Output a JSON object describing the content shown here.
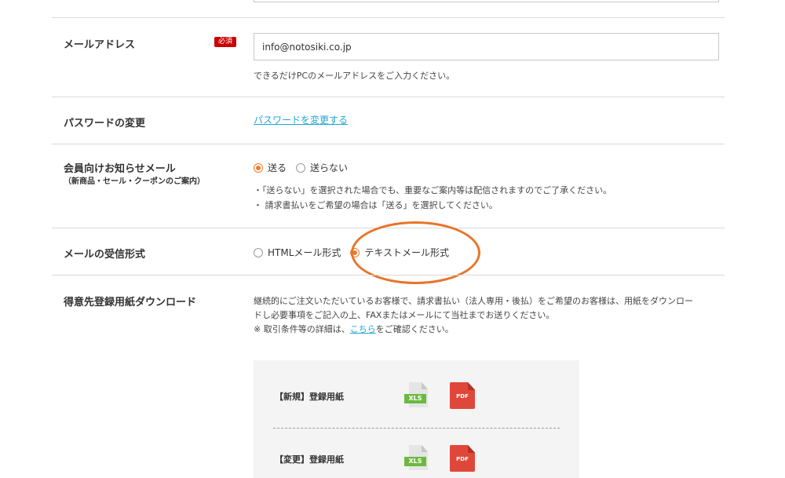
{
  "email": {
    "label": "メールアドレス",
    "required_badge": "必須",
    "value": "info@notosiki.co.jp",
    "hint": "できるだけPCのメールアドレスをご入力ください。"
  },
  "password": {
    "label": "パスワードの変更",
    "link": "パスワードを変更する"
  },
  "newsletter": {
    "label": "会員向けお知らせメール",
    "sublabel": "（新商品・セール・クーポンのご案内）",
    "option_send": "送る",
    "option_nosend": "送らない",
    "selected": "送る",
    "note1": "・「送らない」を選択された場合でも、重要なご案内等は配信されますのでご了承ください。",
    "note2": "・ 請求書払いをご希望の場合は「送る」を選択してください。"
  },
  "mail_format": {
    "label": "メールの受信形式",
    "option_html": "HTMLメール形式",
    "option_text": "テキストメール形式",
    "selected": "テキストメール形式"
  },
  "download": {
    "label": "得意先登録用紙ダウンロード",
    "desc1": "継続的にご注文いただいているお客様で、請求書払い（法人専用・後払）をご希望のお客様は、用紙をダウンロー",
    "desc2": "ドし必要事項をご記入の上、FAXまたはメールにて当社までお送りください。",
    "desc3_pre": "※ 取引条件等の詳細は、",
    "desc3_link": "こちら",
    "desc3_post": "をご確認ください。",
    "rows": [
      {
        "label": "【新規】登録用紙",
        "xls": "XLS",
        "pdf": "PDF"
      },
      {
        "label": "【変更】登録用紙",
        "xls": "XLS",
        "pdf": "PDF"
      }
    ]
  },
  "colors": {
    "accent": "#ee7b2c",
    "link": "#22a6d4",
    "required": "#cc0000",
    "xls": "#6cb93f",
    "pdf": "#e0473b"
  }
}
